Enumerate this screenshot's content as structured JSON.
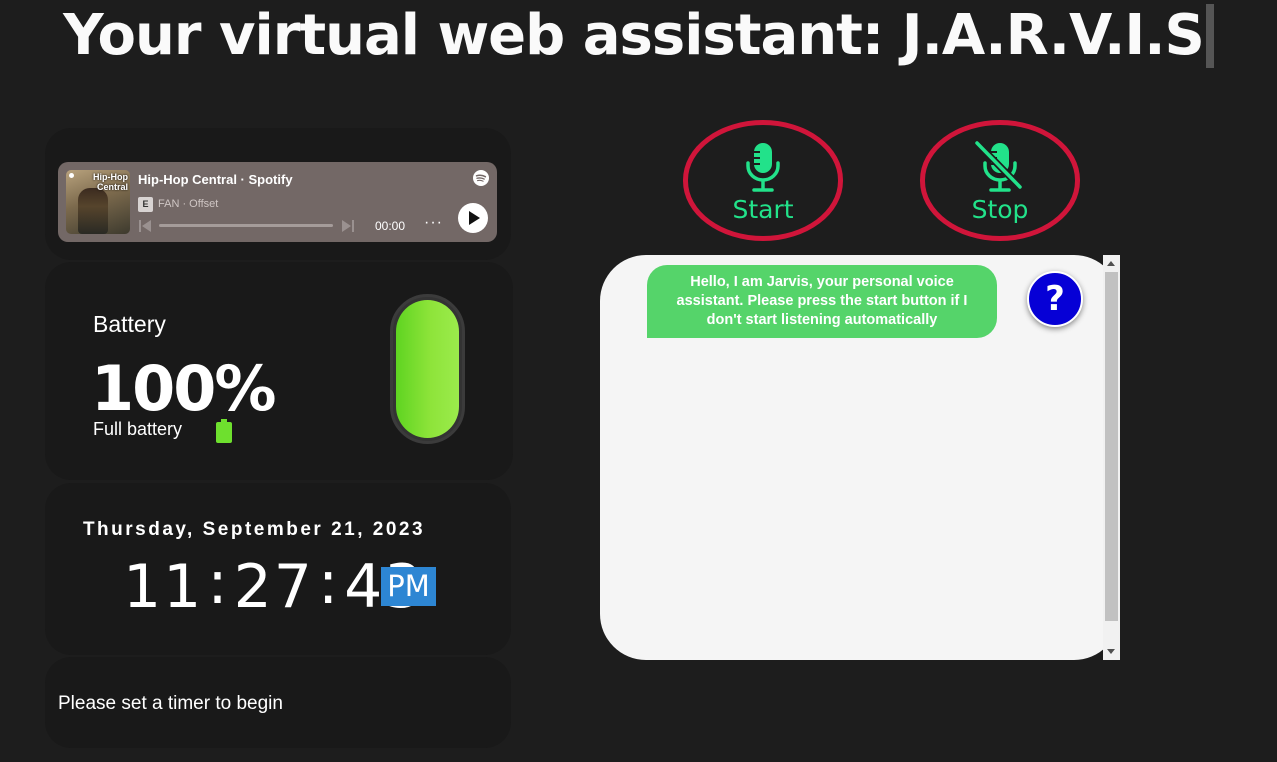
{
  "header": {
    "title": "Your virtual web assistant: J.A.R.V.I.S"
  },
  "spotify": {
    "album_text": "Hip-Hop Central",
    "title": "Hip-Hop Central · Spotify",
    "explicit_badge": "E",
    "song": "FAN · Offset",
    "time": "00:00",
    "more": "···",
    "progress": 0
  },
  "battery": {
    "label": "Battery",
    "percent": "100%",
    "status": "Full battery",
    "level": 1.0,
    "color": "#7be032"
  },
  "clock": {
    "date": "Thursday, September 21, 2023",
    "hours": "11",
    "minutes": "27",
    "seconds": "43",
    "separator": ":",
    "ampm": "PM"
  },
  "timer": {
    "text": "Please set a timer to begin"
  },
  "controls": {
    "start_label": "Start",
    "stop_label": "Stop",
    "border_color": "#d0153a",
    "icon_color": "#22e28a"
  },
  "chat": {
    "messages": [
      {
        "from": "jarvis",
        "text": "Hello, I am Jarvis, your personal voice assistant. Please press the start button if I don't start listening automatically"
      }
    ],
    "help_label": "?"
  }
}
